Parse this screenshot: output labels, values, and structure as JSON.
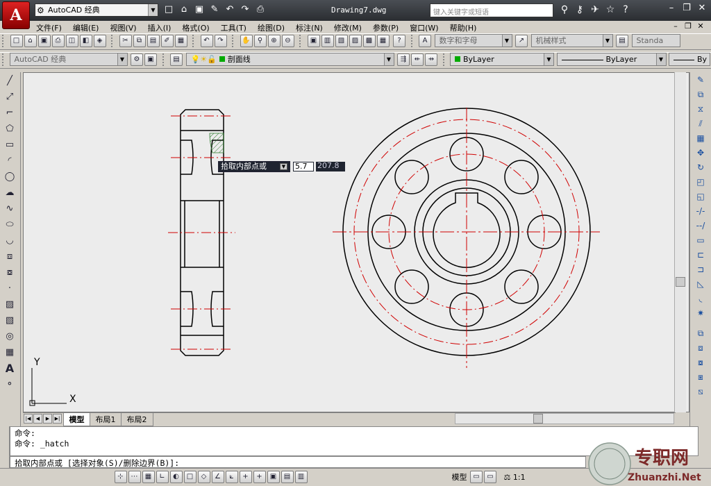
{
  "app": {
    "logo_letter": "A"
  },
  "titlebar": {
    "workspace": "AutoCAD 经典",
    "document_title": "Drawing7.dwg",
    "search_placeholder": "键入关键字或短语",
    "qat_icons": [
      "new-icon",
      "open-icon",
      "save-icon",
      "saveas-icon",
      "undo-icon",
      "redo-icon",
      "print-icon"
    ],
    "tool_icons": [
      "binoculars-icon",
      "key-icon",
      "satellite-icon",
      "star-icon",
      "help-icon"
    ]
  },
  "menu": [
    "文件(F)",
    "编辑(E)",
    "视图(V)",
    "插入(I)",
    "格式(O)",
    "工具(T)",
    "绘图(D)",
    "标注(N)",
    "修改(M)",
    "参数(P)",
    "窗口(W)",
    "帮助(H)"
  ],
  "toolbar1": {
    "text_style": "数字和字母",
    "dim_style": "机械样式",
    "table_style": "Standa"
  },
  "toolbar2": {
    "workspace": "AutoCAD 经典",
    "layer": "剖面线",
    "color": "ByLayer",
    "linetype": "ByLayer",
    "lineweight": "By"
  },
  "tooltip": {
    "label": "拾取内部点或",
    "value1": "5.7",
    "value2": "207.8"
  },
  "ucs": {
    "y_label": "Y",
    "x_label": "X"
  },
  "tabs": {
    "model": "模型",
    "layout1": "布局1",
    "layout2": "布局2"
  },
  "command": {
    "line1": "命令:",
    "line2": "命令: _hatch",
    "prompt": "拾取内部点或 [选择对象(S)/删除边界(B)]:"
  },
  "status": {
    "model": "模型",
    "scale": "1:1"
  },
  "watermark": {
    "brand": "专职网",
    "url": "Zhuanzhi.Net"
  },
  "colors": {
    "accent": "#cc0000",
    "centerline": "#d00000",
    "titlebar": "#2a2d31"
  }
}
